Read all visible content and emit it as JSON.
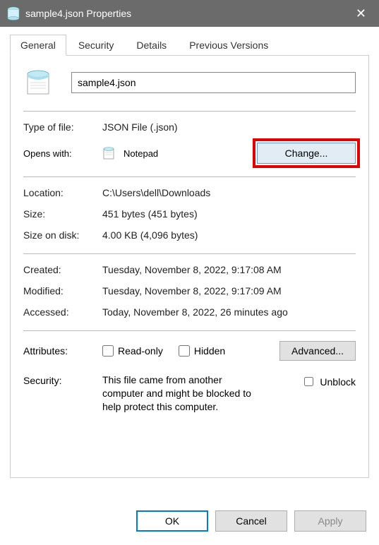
{
  "window": {
    "title": "sample4.json Properties"
  },
  "tabs": {
    "general": "General",
    "security": "Security",
    "details": "Details",
    "previous": "Previous Versions"
  },
  "general": {
    "filename": "sample4.json",
    "typeLabel": "Type of file:",
    "typeValue": "JSON File (.json)",
    "opensWithLabel": "Opens with:",
    "opensWithApp": "Notepad",
    "changeLabel": "Change...",
    "locationLabel": "Location:",
    "locationValue": "C:\\Users\\dell\\Downloads",
    "sizeLabel": "Size:",
    "sizeValue": "451 bytes (451 bytes)",
    "sizeOnDiskLabel": "Size on disk:",
    "sizeOnDiskValue": "4.00 KB (4,096 bytes)",
    "createdLabel": "Created:",
    "createdValue": "Tuesday, November 8, 2022, 9:17:08 AM",
    "modifiedLabel": "Modified:",
    "modifiedValue": "Tuesday, November 8, 2022, 9:17:09 AM",
    "accessedLabel": "Accessed:",
    "accessedValue": "Today, November 8, 2022, 26 minutes ago",
    "attributesLabel": "Attributes:",
    "readonlyLabel": "Read-only",
    "hiddenLabel": "Hidden",
    "advancedLabel": "Advanced...",
    "securityLabel": "Security:",
    "securityText": "This file came from another computer and might be blocked to help protect this computer.",
    "unblockLabel": "Unblock"
  },
  "buttons": {
    "ok": "OK",
    "cancel": "Cancel",
    "apply": "Apply"
  }
}
